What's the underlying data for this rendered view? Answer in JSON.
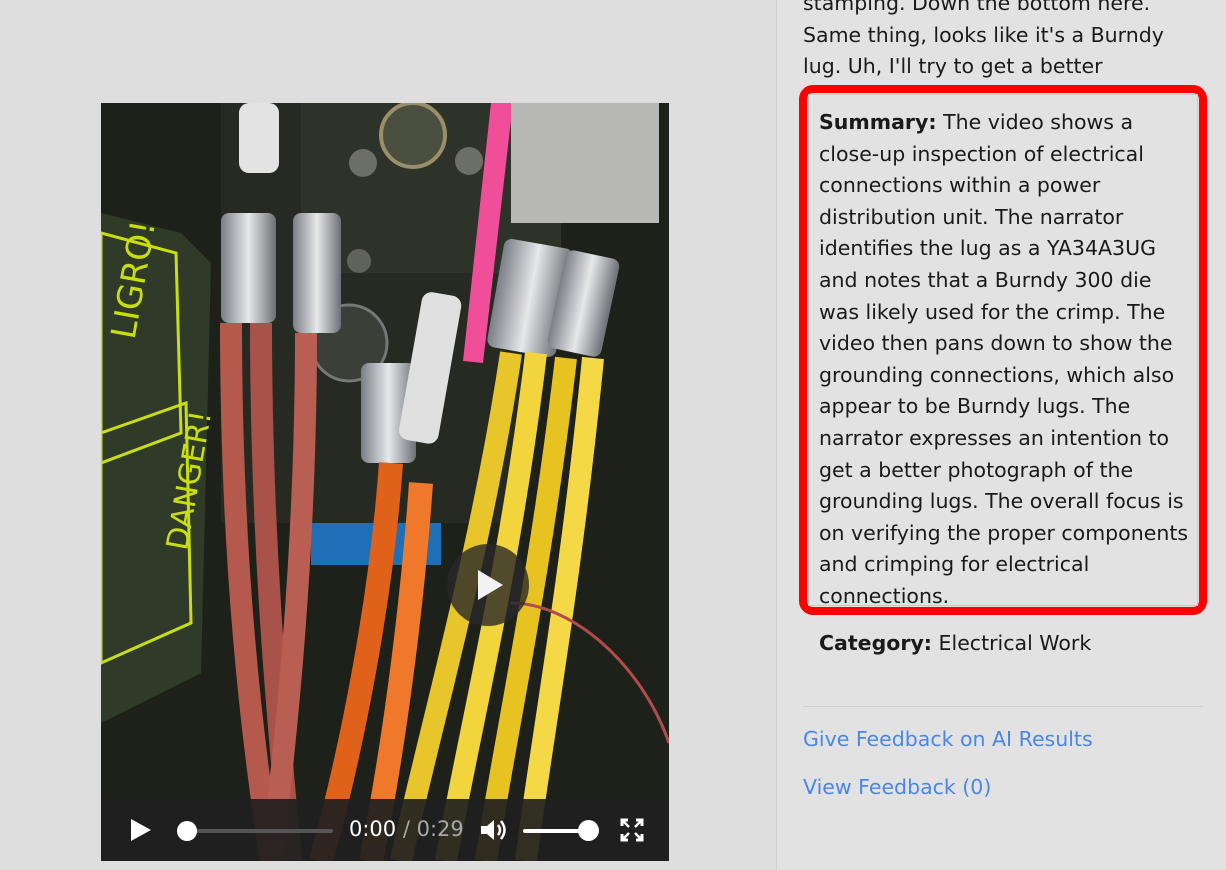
{
  "transcript_excerpt": "stamping. Down the bottom here. Same thing, looks like it's a Burndy lug. Uh, I'll try to get a better photograph.",
  "summary": {
    "label": "Summary:",
    "text": "The video shows a close-up inspection of electrical connections within a power distribution unit. The narrator identifies the lug as a YA34A3UG and notes that a Burndy 300 die was likely used for the crimp. The video then pans down to show the grounding connections, which also appear to be Burndy lugs. The narrator expresses an intention to get a better photograph of the grounding lugs. The overall focus is on verifying the proper components and crimping for electrical connections."
  },
  "category": {
    "label": "Category:",
    "value": "Electrical Work"
  },
  "links": {
    "feedback": "Give Feedback on AI Results",
    "view_feedback": "View Feedback (0)"
  },
  "video": {
    "current_time": "0:00",
    "separator": "/",
    "duration": "0:29",
    "progress": 0,
    "volume": 1.0
  },
  "colors": {
    "highlight_border": "#ff0000",
    "link": "#4a86e8"
  }
}
